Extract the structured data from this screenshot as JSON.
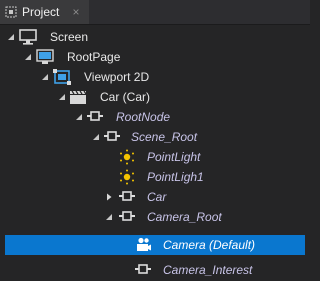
{
  "tab": {
    "title": "Project",
    "close_glyph": "×",
    "icon": "project-panel-icon"
  },
  "colors": {
    "background": "#252526",
    "selection": "#0a77cf",
    "italic_text": "#c8c4e8",
    "light_icon": "#f5c400"
  },
  "tree": [
    {
      "label": "Screen",
      "icon": "screen-monitor-icon",
      "expanded": true,
      "italic": false,
      "selected": false
    },
    {
      "label": "RootPage",
      "icon": "page-icon",
      "expanded": true,
      "italic": false,
      "selected": false
    },
    {
      "label": "Viewport 2D",
      "icon": "viewport-2d-icon",
      "expanded": true,
      "italic": false,
      "selected": false
    },
    {
      "label": "Car (Car)",
      "icon": "scene-clapper-icon",
      "expanded": true,
      "italic": false,
      "selected": false
    },
    {
      "label": "RootNode",
      "icon": "node-icon",
      "expanded": true,
      "italic": true,
      "selected": false
    },
    {
      "label": "Scene_Root",
      "icon": "node-icon",
      "expanded": true,
      "italic": true,
      "selected": false
    },
    {
      "label": "PointLight",
      "icon": "point-light-icon",
      "expanded": null,
      "italic": true,
      "selected": false
    },
    {
      "label": "PointLigh1",
      "icon": "point-light-icon",
      "expanded": null,
      "italic": true,
      "selected": false
    },
    {
      "label": "Car",
      "icon": "node-icon",
      "expanded": false,
      "italic": true,
      "selected": false
    },
    {
      "label": "Camera_Root",
      "icon": "node-icon",
      "expanded": true,
      "italic": true,
      "selected": false
    },
    {
      "label": "Camera (Default)",
      "icon": "camera-icon",
      "expanded": null,
      "italic": true,
      "selected": true
    },
    {
      "label": "Camera_Interest",
      "icon": "node-icon",
      "expanded": null,
      "italic": true,
      "selected": false
    }
  ]
}
